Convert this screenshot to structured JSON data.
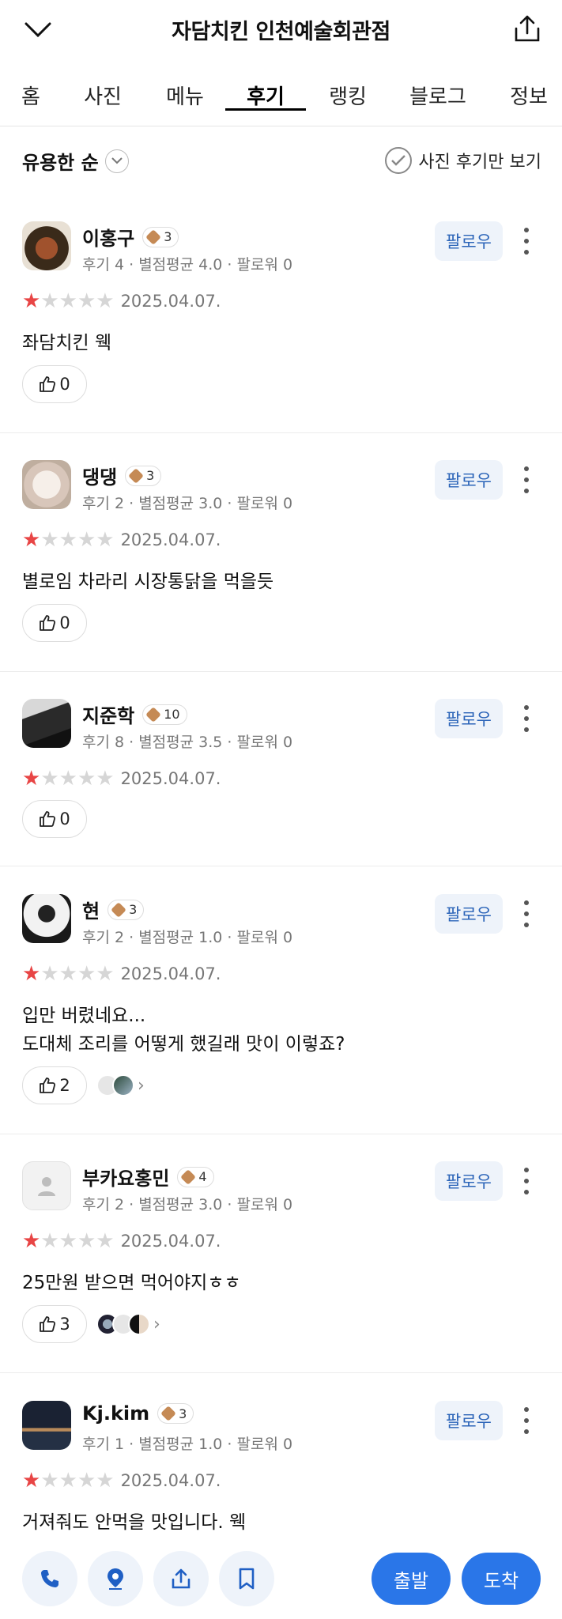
{
  "header": {
    "title": "자담치킨 인천예술회관점",
    "back_icon": "chevron-down-icon",
    "share_icon": "share-icon"
  },
  "tabs": [
    {
      "label": "홈",
      "active": false
    },
    {
      "label": "사진",
      "active": false
    },
    {
      "label": "메뉴",
      "active": false
    },
    {
      "label": "후기",
      "active": true
    },
    {
      "label": "랭킹",
      "active": false
    },
    {
      "label": "블로그",
      "active": false
    },
    {
      "label": "정보",
      "active": false
    }
  ],
  "sort": {
    "label": "유용한 순",
    "photo_only_label": "사진 후기만 보기"
  },
  "follow_label": "팔로우",
  "reviews": [
    {
      "name": "이홍구",
      "level": "3",
      "meta": "후기 4 · 별점평균 4.0 · 팔로워 0",
      "rating": 1,
      "date": "2025.04.07.",
      "text": [
        "좌담치킨 웩"
      ],
      "likes": "0",
      "avatar_color": "#6b4a32"
    },
    {
      "name": "댕댕",
      "level": "3",
      "meta": "후기 2 · 별점평균 3.0 · 팔로워 0",
      "rating": 1,
      "date": "2025.04.07.",
      "text": [
        "별로임 차라리 시장통닭을 먹을듯"
      ],
      "likes": "0",
      "avatar_color": "#e9dcd3"
    },
    {
      "name": "지준학",
      "level": "10",
      "meta": "후기 8 · 별점평균 3.5 · 팔로워 0",
      "rating": 1,
      "date": "2025.04.07.",
      "text": [],
      "likes": "0",
      "avatar_color": "#2b2b2b"
    },
    {
      "name": "현",
      "level": "3",
      "meta": "후기 2 · 별점평균 1.0 · 팔로워 0",
      "rating": 1,
      "date": "2025.04.07.",
      "text": [
        "입만 버렸네요...",
        "도대체 조리를 어떻게 했길래 맛이 이렇죠?"
      ],
      "likes": "2",
      "avatar_color": "#d9d9d9"
    },
    {
      "name": "부카요홍민",
      "level": "4",
      "meta": "후기 2 · 별점평균 3.0 · 팔로워 0",
      "rating": 1,
      "date": "2025.04.07.",
      "text": [
        "25만원 받으면 먹어야지ㅎㅎ"
      ],
      "likes": "3",
      "avatar_color": "#f0f0f0"
    },
    {
      "name": "Kj.kim",
      "level": "3",
      "meta": "후기 1 · 별점평균 1.0 · 팔로워 0",
      "rating": 1,
      "date": "2025.04.07.",
      "text": [
        "거져줘도 안먹을 맛입니다. 웩"
      ],
      "likes": "",
      "avatar_color": "#1e2a3a"
    }
  ],
  "bottom_bar": {
    "depart_label": "출발",
    "arrive_label": "도착"
  },
  "peek_text": "••••••• ••• • •• • ••"
}
